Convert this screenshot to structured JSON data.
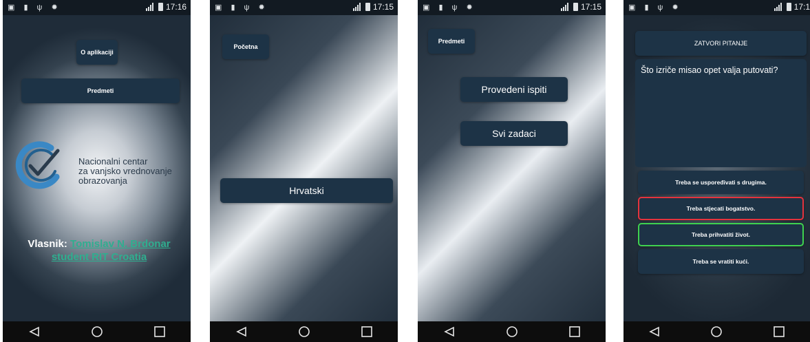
{
  "statusbar": {
    "times": [
      "17:16",
      "17:15",
      "17:15",
      "17:1"
    ]
  },
  "screen1": {
    "about_button": "O aplikaciji",
    "subjects_button": "Predmeti",
    "logo_lines": [
      "Nacionalni centar",
      "za vanjsko vrednovanje",
      "obrazovanja"
    ],
    "owner_label": "Vlasnik:",
    "owner_name": "Tomislav N. Brdonar",
    "owner_role": "student RIT Croatia"
  },
  "screen2": {
    "home_button": "Početna",
    "subject_button": "Hrvatski"
  },
  "screen3": {
    "subjects_button": "Predmeti",
    "exams_button": "Provedeni ispiti",
    "all_tasks_button": "Svi zadaci"
  },
  "screen4": {
    "close_button": "ZATVORI PITANJE",
    "question_text": "Što izriče misao opet valja putovati?",
    "answers": [
      {
        "label": "Treba se uspoređivati s drugima.",
        "state": "normal"
      },
      {
        "label": "Treba stjecati bogatstvo.",
        "state": "wrong"
      },
      {
        "label": "Treba prihvatiti život.",
        "state": "correct"
      },
      {
        "label": "Treba se vratiti kući.",
        "state": "normal"
      }
    ]
  },
  "colors": {
    "button_bg": "#1d3346",
    "wrong_border": "#e5333d",
    "correct_border": "#3fd24f",
    "link_green": "#2fae8f"
  },
  "navbar_icons": [
    "back-triangle-icon",
    "home-circle-icon",
    "recents-square-icon"
  ]
}
